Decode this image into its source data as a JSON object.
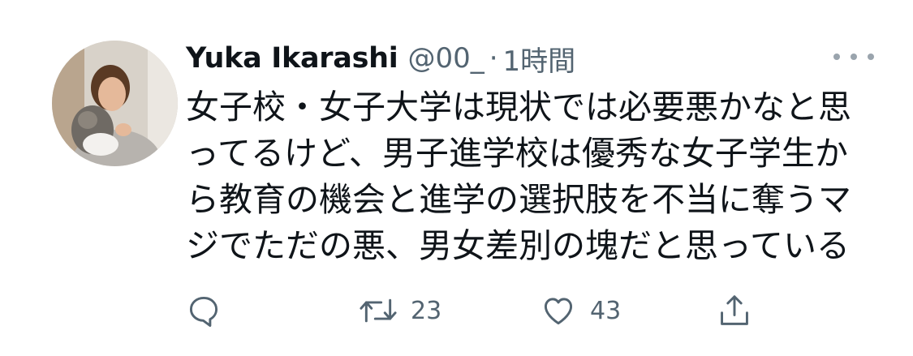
{
  "author": {
    "name": "Yuka Ikarashi",
    "handle": "@00_",
    "separator": "·",
    "time": "1時間"
  },
  "tweet": {
    "lines": [
      "女子校・女子大学は現状では必要悪かなと思",
      "ってるけど、男子進学校は優秀な女子学生か",
      "ら教育の機会と進学の選択肢を不当に奪うマ",
      "ジでただの悪、男女差別の塊だと思っている"
    ]
  },
  "actions": {
    "reply_icon": "reply-icon",
    "retweet_icon": "retweet-icon",
    "retweet_count": "23",
    "like_icon": "heart-icon",
    "like_count": "43",
    "share_icon": "share-icon"
  },
  "colors": {
    "text_primary": "#0f1419",
    "text_secondary": "#536471",
    "background": "#ffffff"
  }
}
